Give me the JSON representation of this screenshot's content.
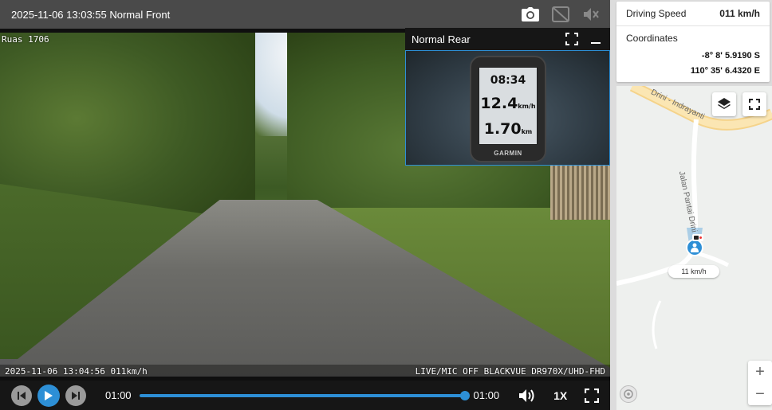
{
  "topbar": {
    "title": "2025-11-06 13:03:55 Normal Front"
  },
  "front_video": {
    "segment_label": "Ruas 1706",
    "overlay_left": "2025-11-06 13:04:56 011km/h",
    "overlay_right": "LIVE/MIC OFF BLACKVUE DR970X/UHD-FHD"
  },
  "rear_video": {
    "title": "Normal Rear",
    "gps_time": "08:34",
    "gps_speed": "12.4",
    "gps_speed_unit": "km/h",
    "gps_distance": "1.70",
    "gps_distance_unit": "km",
    "gps_brand": "GARMIN"
  },
  "controls": {
    "current_time": "01:00",
    "end_time": "01:00",
    "progress": 1.0,
    "playback_speed": "1X"
  },
  "info": {
    "speed_label": "Driving Speed",
    "speed_value": "011 km/h",
    "coords_label": "Coordinates",
    "latitude": "-8° 8' 5.9190 S",
    "longitude": "110° 35' 6.4320 E"
  },
  "map": {
    "road_label_1": "Drini - Indrayanti",
    "road_label_2": "Jalan Pantai Drini",
    "vehicle_speed": "11 km/h",
    "zoom_in": "+",
    "zoom_out": "−"
  },
  "colors": {
    "accent": "#2d8fd6",
    "topbar": "#4a4a4a",
    "road_main": "#f5d38a"
  }
}
